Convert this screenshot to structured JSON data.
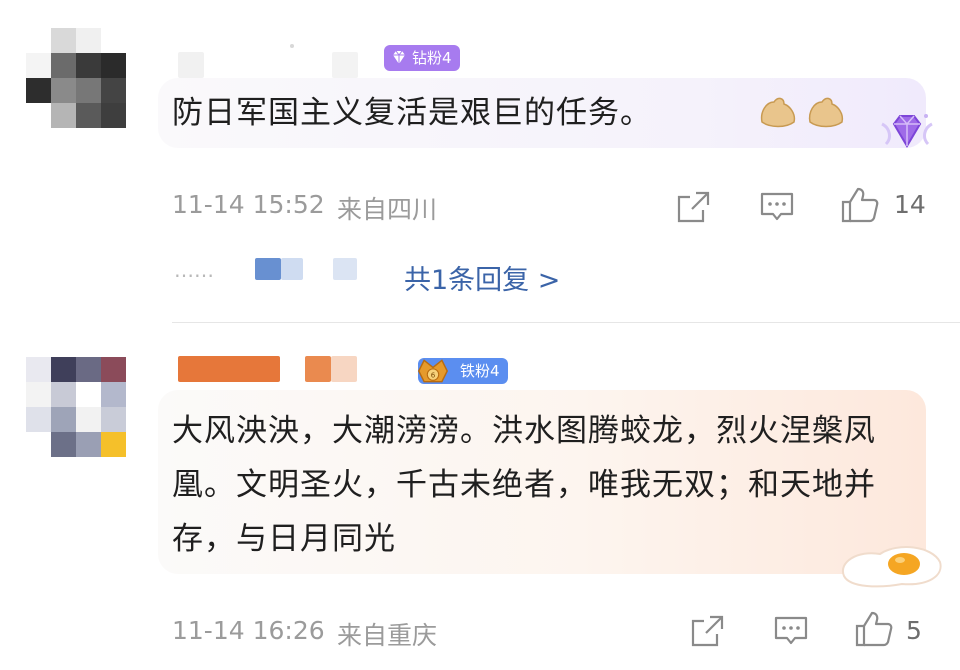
{
  "comments": [
    {
      "badge": "钻粉4",
      "text": "防日军国主义复活是艰巨的任务。",
      "emoji": "💪💪",
      "timestamp": "11-14 15:52",
      "location": "来自四川",
      "likes": "14",
      "reply_summary": "共1条回复 >",
      "reply_dots": "……"
    },
    {
      "badge": "铁粉4",
      "text": "大风泱泱，大潮滂滂。洪水图腾蛟龙，烈火涅槃凤凰。文明圣火，千古未绝者，唯我无双；和天地并存，与日月同光",
      "timestamp": "11-14 16:26",
      "location": "来自重庆",
      "likes": "5"
    }
  ],
  "icons": {
    "share": "share-icon",
    "reply": "comment-icon",
    "like": "thumbs-up-icon"
  },
  "colors": {
    "badge_diamond": "#a77bef",
    "badge_iron": "#5b8ef0",
    "reply_link": "#3b64a8",
    "meta_text": "#9b9b9b"
  }
}
